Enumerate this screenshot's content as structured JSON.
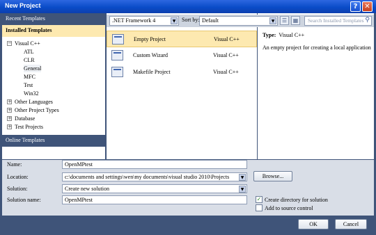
{
  "window": {
    "title": "New Project",
    "help_glyph": "?",
    "close_glyph": "✕"
  },
  "left_panel": {
    "recent_templates": "Recent Templates",
    "installed_templates": "Installed Templates",
    "online_templates": "Online Templates",
    "tree": [
      {
        "label": "Visual C++",
        "toggle": "⊟"
      },
      {
        "label": "ATL"
      },
      {
        "label": "CLR"
      },
      {
        "label": "General",
        "selected": true
      },
      {
        "label": "MFC"
      },
      {
        "label": "Test"
      },
      {
        "label": "Win32"
      },
      {
        "label": "Other Languages",
        "toggle": "⊞"
      },
      {
        "label": "Other Project Types",
        "toggle": "⊞"
      },
      {
        "label": "Database",
        "toggle": "⊞"
      },
      {
        "label": "Test Projects",
        "toggle": "⊞"
      }
    ]
  },
  "toolbar": {
    "framework": ".NET Framework 4",
    "sort_label": "Sort by:",
    "sort_value": "Default",
    "search_placeholder": "Search Installed Templates"
  },
  "templates": [
    {
      "name": "Empty Project",
      "language": "Visual C++",
      "selected": true
    },
    {
      "name": "Custom Wizard",
      "language": "Visual C++"
    },
    {
      "name": "Makefile Project",
      "language": "Visual C++"
    }
  ],
  "details": {
    "type_label": "Type:",
    "type_value": "Visual C++",
    "description": "An empty project for creating a local application"
  },
  "form": {
    "name_label": "Name:",
    "name_value": "OpenMPtest",
    "location_label": "Location:",
    "location_value": "c:\\documents and settings\\wen\\my documents\\visual studio 2010\\Projects",
    "browse_label": "Browse...",
    "solution_label": "Solution:",
    "solution_value": "Create new solution",
    "solution_name_label": "Solution name:",
    "solution_name_value": "OpenMPtest",
    "create_dir_label": "Create directory for solution",
    "create_dir_checked": true,
    "add_source_control_label": "Add to source control",
    "add_source_control_checked": false
  },
  "buttons": {
    "ok": "OK",
    "cancel": "Cancel"
  }
}
